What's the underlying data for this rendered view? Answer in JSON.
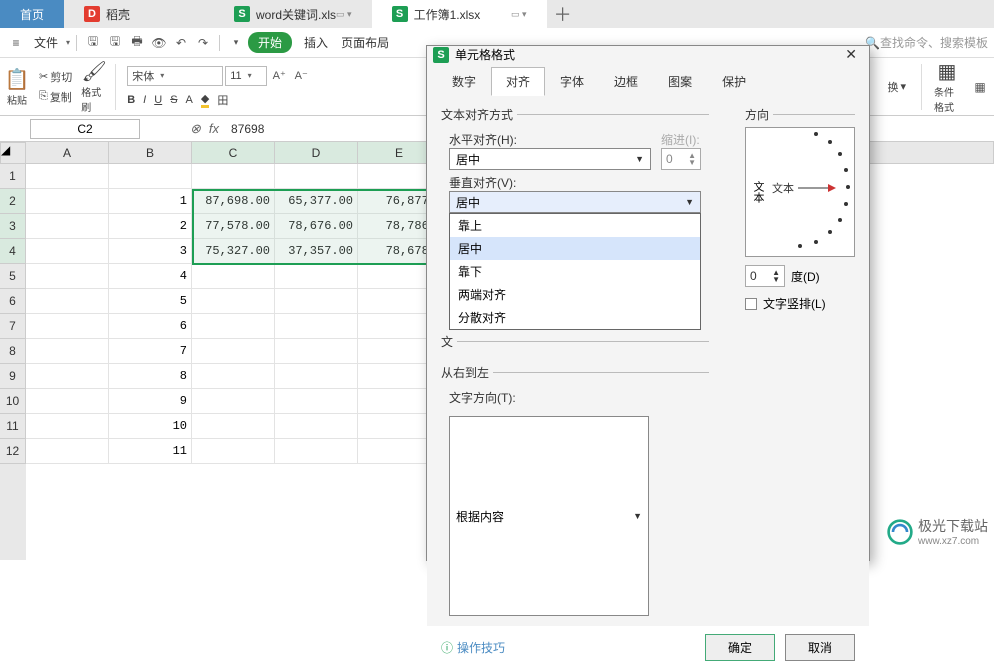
{
  "tabs": {
    "home": "首页",
    "t1": "稻壳",
    "t2": "word关键词.xls",
    "t3": "工作簿1.xlsx"
  },
  "menu": {
    "file": "文件",
    "start": "开始",
    "items": [
      "插入",
      "页面布局"
    ],
    "search": "查找命令、搜索模板"
  },
  "ribbon": {
    "paste": "粘贴",
    "cut": "剪切",
    "copy": "复制",
    "brush": "格式刷",
    "font": "宋体",
    "size": "11",
    "cond": "条件格式",
    "swap": "换"
  },
  "formula": {
    "ref": "C2",
    "fx": "fx",
    "val": "87698"
  },
  "cols": [
    "A",
    "B",
    "C",
    "D",
    "E"
  ],
  "rows": [
    "1",
    "2",
    "3",
    "4",
    "5",
    "6",
    "7",
    "8",
    "9",
    "10",
    "11",
    "12"
  ],
  "data": {
    "b": [
      "1",
      "2",
      "3",
      "4",
      "5",
      "6",
      "7",
      "8",
      "9",
      "10",
      "11"
    ],
    "r2": [
      "87,698.00",
      "65,377.00",
      "76,877."
    ],
    "r3": [
      "77,578.00",
      "78,676.00",
      "78,786."
    ],
    "r4": [
      "75,327.00",
      "37,357.00",
      "78,678."
    ]
  },
  "dialog": {
    "title": "单元格格式",
    "tabs": [
      "数字",
      "对齐",
      "字体",
      "边框",
      "图案",
      "保护"
    ],
    "sec_align": "文本对齐方式",
    "h_align_lbl": "水平对齐(H):",
    "h_align_val": "居中",
    "indent_lbl": "缩进(I):",
    "indent_val": "0",
    "v_align_lbl": "垂直对齐(V):",
    "v_align_val": "居中",
    "v_options": [
      "靠上",
      "居中",
      "靠下",
      "两端对齐",
      "分散对齐"
    ],
    "sec_txtctl": "文",
    "sec_rtl": "从右到左",
    "txtdir_lbl": "文字方向(T):",
    "txtdir_val": "根据内容",
    "sec_orient": "方向",
    "orient_v": "文本",
    "orient_h": "文本",
    "degree_val": "0",
    "degree_lbl": "度(D)",
    "vtext_lbl": "文字竖排(L)",
    "tips": "操作技巧",
    "ok": "确定",
    "cancel": "取消"
  },
  "watermark": {
    "site": "极光下载站",
    "url": "www.xz7.com"
  }
}
